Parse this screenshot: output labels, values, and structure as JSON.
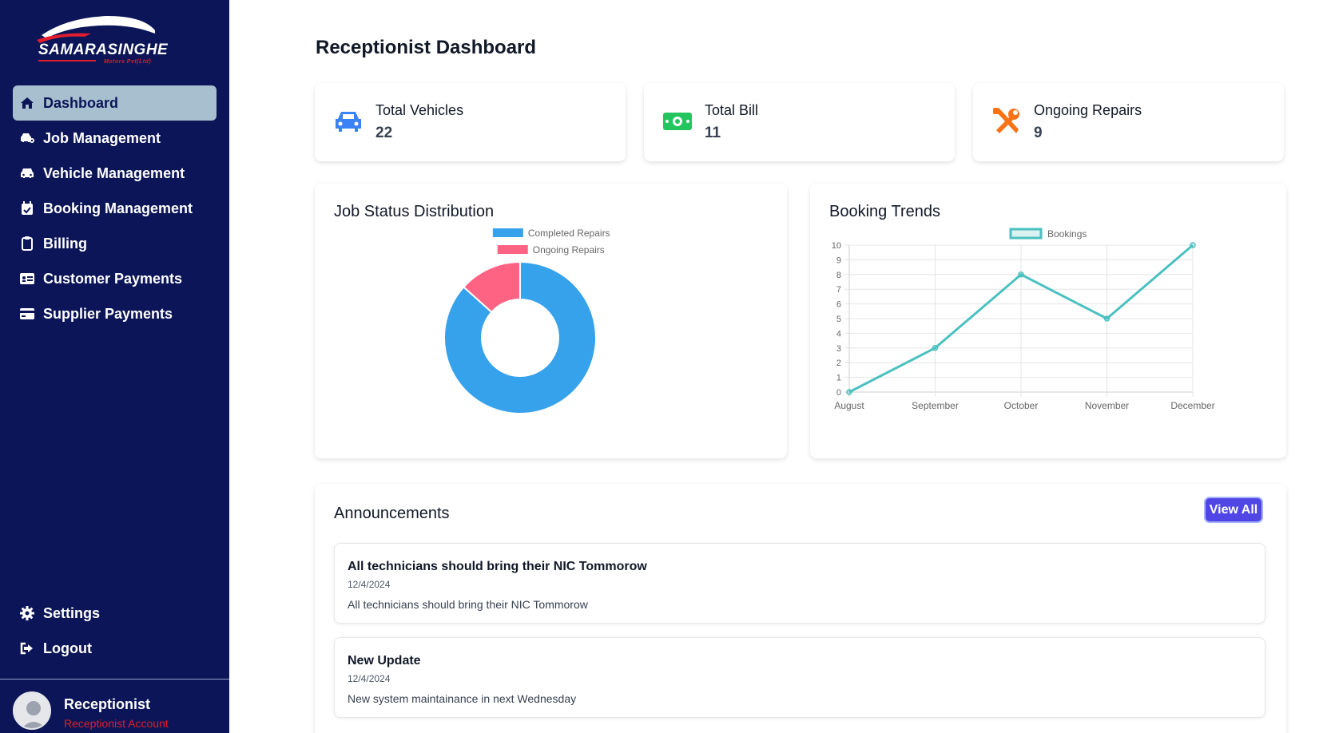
{
  "brand": {
    "name": "SAMARASINGHE",
    "sub": "Motors Pvt(Ltd)",
    "accent": "#e11d2e"
  },
  "sidebar": {
    "items": [
      {
        "label": "Dashboard",
        "icon": "home-icon",
        "active": true
      },
      {
        "label": "Job Management",
        "icon": "car-tool-icon"
      },
      {
        "label": "Vehicle Management",
        "icon": "car-icon"
      },
      {
        "label": "Booking Management",
        "icon": "calendar-check-icon"
      },
      {
        "label": "Billing",
        "icon": "clipboard-icon"
      },
      {
        "label": "Customer Payments",
        "icon": "id-card-icon"
      },
      {
        "label": "Supplier Payments",
        "icon": "credit-card-icon"
      }
    ],
    "bottom": [
      {
        "label": "Settings",
        "icon": "gear-icon"
      },
      {
        "label": "Logout",
        "icon": "logout-icon"
      }
    ],
    "user": {
      "name": "Receptionist",
      "role": "Receptionist Account"
    }
  },
  "page": {
    "title": "Receptionist Dashboard"
  },
  "stats": [
    {
      "label": "Total Vehicles",
      "value": "22",
      "icon": "car-icon",
      "color": "#3b82f6"
    },
    {
      "label": "Total Bill",
      "value": "11",
      "icon": "money-bill-icon",
      "color": "#22c55e"
    },
    {
      "label": "Ongoing Repairs",
      "value": "9",
      "icon": "tools-icon",
      "color": "#f97316"
    }
  ],
  "charts": {
    "job_status_title": "Job Status Distribution",
    "booking_trends_title": "Booking Trends"
  },
  "chart_data": [
    {
      "type": "pie",
      "title": "Job Status Distribution",
      "categories": [
        "Completed Repairs",
        "Ongoing Repairs"
      ],
      "values": [
        13,
        2
      ],
      "colors": [
        "#36a2eb",
        "#ff6384"
      ],
      "legend": "top"
    },
    {
      "type": "line",
      "title": "Booking Trends",
      "x": [
        "August",
        "September",
        "October",
        "November",
        "December"
      ],
      "series": [
        {
          "name": "Bookings",
          "values": [
            0,
            3,
            8,
            5,
            10
          ],
          "color": "#4bc0c0"
        }
      ],
      "ylim": [
        0,
        10
      ],
      "yticks": [
        0,
        1,
        2,
        3,
        4,
        5,
        6,
        7,
        8,
        9,
        10
      ],
      "grid": true,
      "legend": "top"
    }
  ],
  "announcements": {
    "title": "Announcements",
    "view_all": "View All",
    "items": [
      {
        "title": "All technicians should bring their NIC Tommorow",
        "date": "12/4/2024",
        "body": "All technicians should bring their NIC Tommorow"
      },
      {
        "title": "New Update",
        "date": "12/4/2024",
        "body": "New system maintainance in next Wednesday"
      }
    ]
  }
}
